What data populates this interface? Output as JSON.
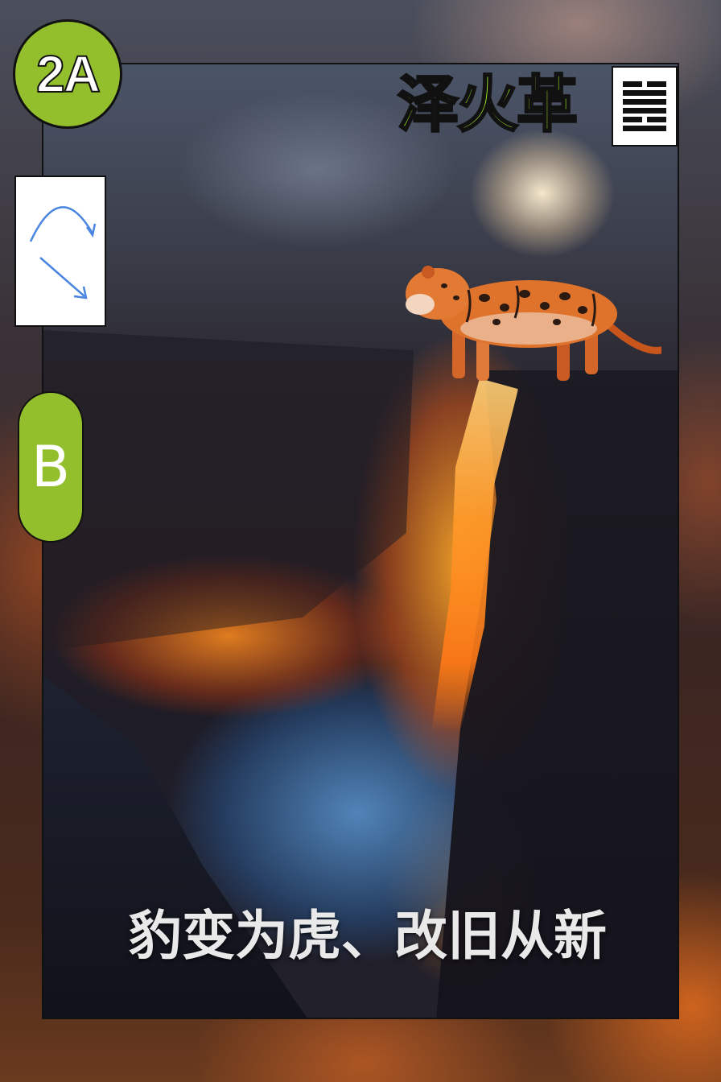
{
  "badge_top": "2A",
  "badge_side": "B",
  "title": "泽火革",
  "caption": "豹变为虎、改旧从新",
  "hexagram": {
    "name": "hexagram-ge-icon",
    "lines_top_to_bottom": [
      "broken",
      "solid",
      "solid",
      "solid",
      "broken",
      "solid"
    ]
  },
  "arrows_icon": "curved-arrows-icon",
  "colors": {
    "accent_green": "#94bf2c",
    "title_green": "#a6f026",
    "arrow_blue": "#4a86e0",
    "lava": "#ff8a20"
  }
}
